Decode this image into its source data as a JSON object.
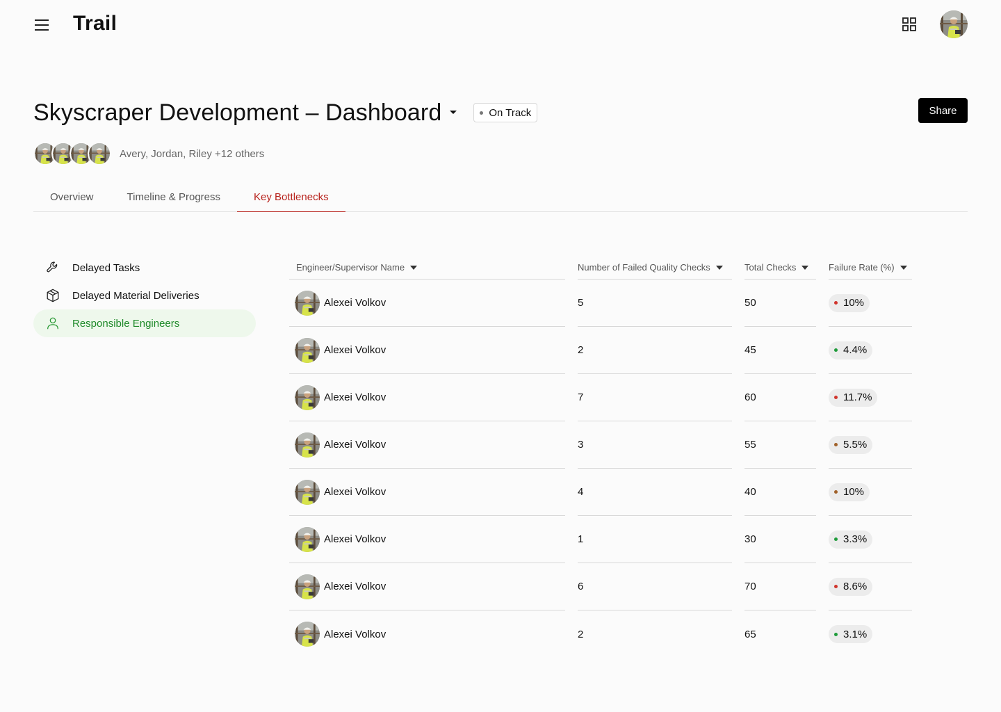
{
  "app": {
    "brand": "Trail"
  },
  "header": {
    "title": "Skyscraper Development – Dashboard",
    "status": "On Track",
    "share_label": "Share",
    "members_text": "Avery, Jordan, Riley +12 others"
  },
  "tabs": [
    {
      "label": "Overview",
      "active": false
    },
    {
      "label": "Timeline & Progress",
      "active": false
    },
    {
      "label": "Key Bottlenecks",
      "active": true
    }
  ],
  "sidebar": {
    "items": [
      {
        "label": "Delayed Tasks",
        "icon": "wrench-icon",
        "active": false
      },
      {
        "label": "Delayed Material Deliveries",
        "icon": "package-icon",
        "active": false
      },
      {
        "label": "Responsible Engineers",
        "icon": "user-icon",
        "active": true
      }
    ]
  },
  "table": {
    "columns": [
      "Engineer/Supervisor Name",
      "Number of Failed Quality Checks",
      "Total Checks",
      "Failure Rate (%)"
    ],
    "rows": [
      {
        "name": "Alexei Volkov",
        "failed": "5",
        "total": "50",
        "rate": "10%",
        "status_color": "#d0342c"
      },
      {
        "name": "Alexei Volkov",
        "failed": "2",
        "total": "45",
        "rate": "4.4%",
        "status_color": "#1e9b3a"
      },
      {
        "name": "Alexei Volkov",
        "failed": "7",
        "total": "60",
        "rate": "11.7%",
        "status_color": "#d0342c"
      },
      {
        "name": "Alexei Volkov",
        "failed": "3",
        "total": "55",
        "rate": "5.5%",
        "status_color": "#a0612a"
      },
      {
        "name": "Alexei Volkov",
        "failed": "4",
        "total": "40",
        "rate": "10%",
        "status_color": "#a0612a"
      },
      {
        "name": "Alexei Volkov",
        "failed": "1",
        "total": "30",
        "rate": "3.3%",
        "status_color": "#1e9b3a"
      },
      {
        "name": "Alexei Volkov",
        "failed": "6",
        "total": "70",
        "rate": "8.6%",
        "status_color": "#d0342c"
      },
      {
        "name": "Alexei Volkov",
        "failed": "2",
        "total": "65",
        "rate": "3.1%",
        "status_color": "#1e9b3a"
      }
    ]
  },
  "colors": {
    "accent_red": "#b8231d",
    "active_green": "#1f8a2a",
    "active_green_bg": "#eef8ec"
  }
}
